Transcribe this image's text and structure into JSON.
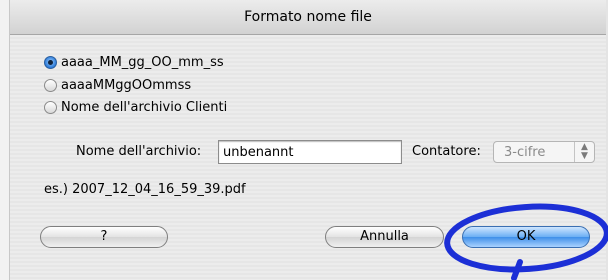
{
  "dialog": {
    "title": "Formato nome file",
    "options": [
      {
        "label": "aaaa_MM_gg_OO_mm_ss",
        "selected": true
      },
      {
        "label": "aaaaMMggOOmmss",
        "selected": false
      },
      {
        "label": "Nome dell'archivio Clienti",
        "selected": false
      }
    ],
    "filename_label": "Nome dell'archivio:",
    "filename_value": "unbenannt",
    "counter_label": "Contatore:",
    "counter_value": "3-cifre",
    "example": "es.) 2007_12_04_16_59_39.pdf",
    "buttons": {
      "help": "?",
      "cancel": "Annulla",
      "ok": "OK"
    }
  },
  "colors": {
    "annotation": "#1c2fd6",
    "ok_button": "#4a97ec"
  }
}
